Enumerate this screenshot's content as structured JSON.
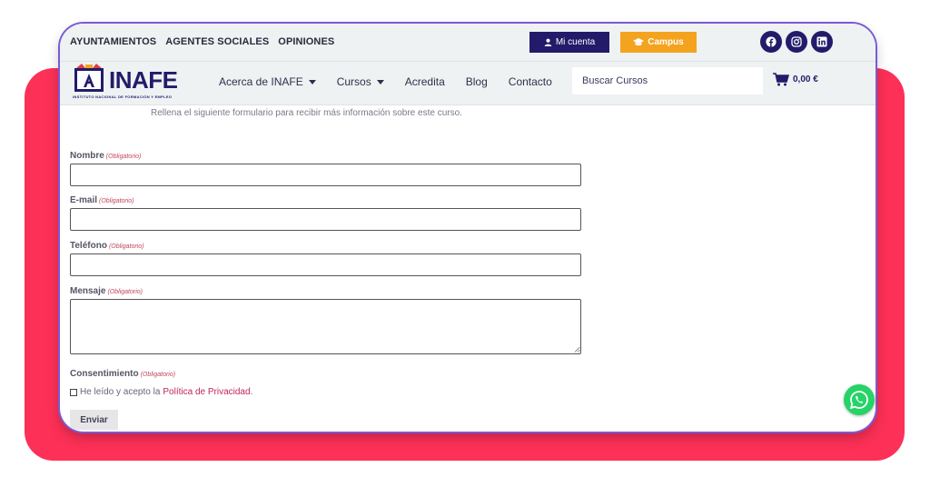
{
  "top_links": [
    "AYUNTAMIENTOS",
    "AGENTES SOCIALES",
    "OPINIONES"
  ],
  "account_button": "Mi cuenta",
  "campus_button": "Campus",
  "socials": [
    "facebook-icon",
    "instagram-icon",
    "linkedin-icon"
  ],
  "logo": {
    "word": "INAFE",
    "sub": "INSTITUTO NACIONAL DE FORMACIÓN Y EMPLEO"
  },
  "nav": [
    {
      "label": "Acerca de INAFE",
      "dropdown": true
    },
    {
      "label": "Cursos",
      "dropdown": true
    },
    {
      "label": "Acredita",
      "dropdown": false
    },
    {
      "label": "Blog",
      "dropdown": false
    },
    {
      "label": "Contacto",
      "dropdown": false
    }
  ],
  "search_placeholder": "Buscar Cursos",
  "cart_total": "0,00 €",
  "form": {
    "intro": "Rellena el siguiente formulario para recibir más información sobre este curso.",
    "required_tag": "(Obligatorio)",
    "fields": {
      "name": "Nombre",
      "email": "E-mail",
      "phone": "Teléfono",
      "message": "Mensaje",
      "consent": "Consentimiento"
    },
    "consent_text": "He leído y acepto la",
    "policy_link": "Política de Privacidad",
    "policy_end": ".",
    "submit": "Enviar"
  },
  "colors": {
    "brand_navy": "#231b6a",
    "campus_orange": "#f4a31f",
    "backdrop_red": "#fd3057",
    "link_red": "#c2245a",
    "whatsapp_green": "#25d366"
  }
}
